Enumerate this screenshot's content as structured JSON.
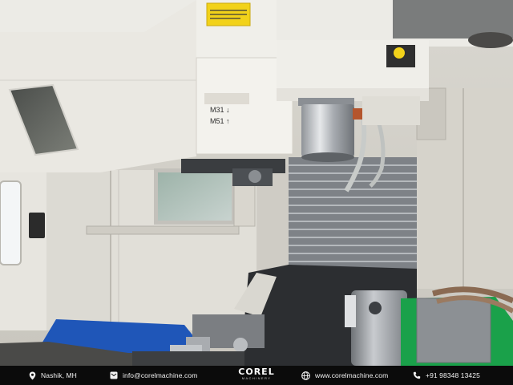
{
  "scene": {
    "machine_label_text": "M31 ↓\nM51 ↑"
  },
  "footer": {
    "location": {
      "icon": "location-pin-icon",
      "text": "Nashik, MH"
    },
    "email": {
      "icon": "email-icon",
      "text": "info@corelmachine.com"
    },
    "brand": {
      "name": "COREL",
      "tagline": "MACHINERY"
    },
    "website": {
      "icon": "globe-icon",
      "text": "www.corelmachine.com"
    },
    "phone": {
      "icon": "phone-icon",
      "text": "+91 98348 13425"
    }
  },
  "colors": {
    "machine_white": "#e9e7e1",
    "enclosure_panel": "#d8d6cf",
    "blue_tray": "#1f56b8",
    "green_fixture": "#1aa14a",
    "warning_yellow": "#f2d21a",
    "footer_bg": "#0b0b0b",
    "footer_text": "#f2f2f2"
  }
}
